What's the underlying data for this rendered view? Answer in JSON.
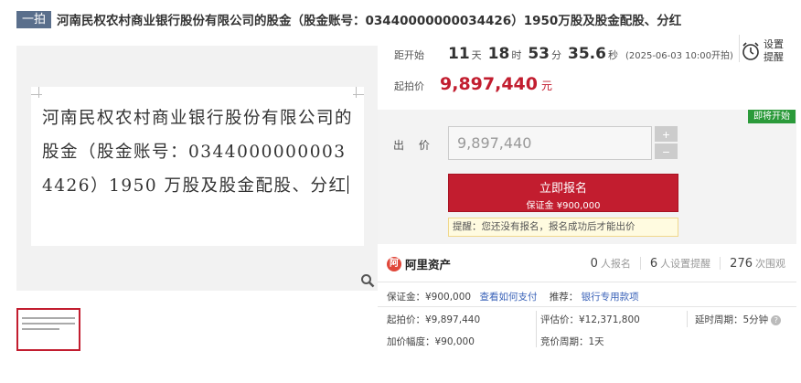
{
  "title": {
    "badge": "一拍",
    "text": "河南民权农村商业银行股份有限公司的股金（股金账号：03440000000034426）1950万股及股金配股、分红"
  },
  "preview": {
    "document_text": "河南民权农村商业银行股份有限公司的股金（股金账号：03440000000034426）1950 万股及股金配股、分红"
  },
  "countdown": {
    "label": "距开始",
    "days": "11",
    "days_unit": "天",
    "hours": "18",
    "hours_unit": "时",
    "minutes": "53",
    "minutes_unit": "分",
    "seconds": "35.6",
    "seconds_unit": "秒",
    "start_time": "(2025-06-03 10:00开拍)"
  },
  "reminder": {
    "line1": "设置",
    "line2": "提醒",
    "icon": "alarm-clock-icon"
  },
  "start_price": {
    "label": "起拍价",
    "value": "9,897,440",
    "unit": "元"
  },
  "soon_tag": "即将开始",
  "bid": {
    "label": "出 价",
    "value": "9,897,440",
    "plus": "+",
    "minus": "−",
    "button_main": "立即报名",
    "button_sub": "保证金 ¥900,000",
    "hint": "提醒：您还没有报名，报名成功后才能出价"
  },
  "platform": {
    "name": "阿里资产",
    "signups": "0",
    "signups_label": "人报名",
    "reminders": "6",
    "reminders_label": "人设置提醒",
    "views": "276",
    "views_label": "次围观"
  },
  "details": {
    "deposit": "保证金：¥900,000",
    "how_to_pay": "查看如何支付",
    "recommend_label": "推荐：",
    "recommend_link": "银行专用款项",
    "start_price": "起拍价：¥9,897,440",
    "appraisal": "评估价：¥12,371,800",
    "delay": "延时周期：5分钟",
    "increment": "加价幅度：¥90,000",
    "cycle": "竞价周期：1天"
  },
  "colors": {
    "accent": "#c21d2f",
    "badge": "#5a6f8c",
    "green": "#2b9a3a",
    "link": "#3a62b8"
  }
}
